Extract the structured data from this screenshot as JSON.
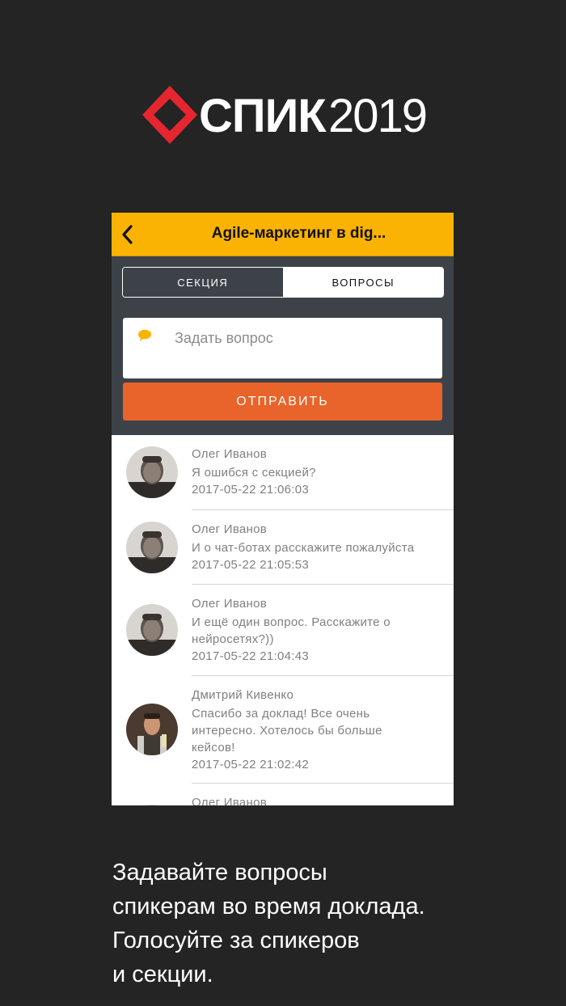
{
  "brand": {
    "word": "СПИК",
    "year": "2019",
    "accent_color": "#e5262f"
  },
  "navbar": {
    "title": "Agile-маркетинг в dig...",
    "back_icon": "chevron-left-icon",
    "bg_color": "#fbb303"
  },
  "tabs": [
    {
      "label": "СЕКЦИЯ",
      "selected": false
    },
    {
      "label": "ВОПРОСЫ",
      "selected": true
    }
  ],
  "question_form": {
    "placeholder": "Задать вопрос",
    "icon": "chat-bubble-icon",
    "submit_label": "ОТПРАВИТЬ",
    "submit_color": "#e8642a"
  },
  "questions": [
    {
      "author": "Олег Иванов",
      "text": "Я ошибся с секцией?",
      "time": "2017-05-22 21:06:03",
      "avatar": "oleg"
    },
    {
      "author": "Олег Иванов",
      "text": "И о чат-ботах расскажите пожалуйста",
      "time": "2017-05-22 21:05:53",
      "avatar": "oleg"
    },
    {
      "author": "Олег Иванов",
      "text": "И ещё один вопрос. Расскажите о нейросетях?))",
      "time": "2017-05-22 21:04:43",
      "avatar": "oleg"
    },
    {
      "author": "Дмитрий Кивенко",
      "text": "Спасибо за доклад! Все очень интересно. Хотелось бы больше кейсов!",
      "time": "2017-05-22 21:02:42",
      "avatar": "dmitry"
    },
    {
      "author": "Олег Иванов",
      "text": "",
      "time": "",
      "avatar": "oleg"
    }
  ],
  "caption": {
    "lines": [
      "Задавайте вопросы",
      "спикерам во время доклада.",
      "Голосуйте за спикеров",
      "и секции."
    ]
  }
}
